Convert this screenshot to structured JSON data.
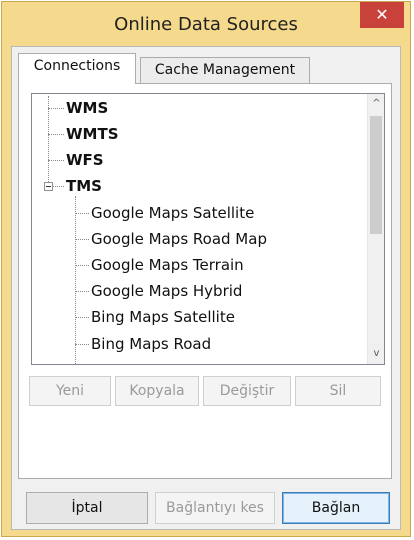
{
  "window": {
    "title": "Online Data Sources",
    "close_glyph": "✕"
  },
  "tabs": [
    {
      "label": "Connections",
      "active": true
    },
    {
      "label": "Cache Management",
      "active": false
    }
  ],
  "tree": {
    "items": [
      {
        "label": "WMS",
        "bold": true
      },
      {
        "label": "WMTS",
        "bold": true
      },
      {
        "label": "WFS",
        "bold": true
      },
      {
        "label": "TMS",
        "bold": true,
        "expanded": true
      },
      {
        "label": "Google Maps Satellite",
        "bold": false
      },
      {
        "label": "Google Maps Road Map",
        "bold": false
      },
      {
        "label": "Google Maps Terrain",
        "bold": false
      },
      {
        "label": "Google Maps Hybrid",
        "bold": false
      },
      {
        "label": "Bing Maps Satellite",
        "bold": false
      },
      {
        "label": "Bing Maps Road",
        "bold": false
      }
    ],
    "scroll_up_glyph": "^",
    "scroll_down_glyph": "v"
  },
  "action_buttons": [
    {
      "label": "Yeni",
      "enabled": false
    },
    {
      "label": "Kopyala",
      "enabled": false
    },
    {
      "label": "Değiştir",
      "enabled": false
    },
    {
      "label": "Sil",
      "enabled": false
    }
  ],
  "footer_buttons": [
    {
      "label": "İptal",
      "enabled": true
    },
    {
      "label": "Bağlantıyı kes",
      "enabled": false
    },
    {
      "label": "Bağlan",
      "enabled": true,
      "default": true
    }
  ],
  "colors": {
    "frame": "#f5d98c",
    "close_button": "#c8413a"
  }
}
